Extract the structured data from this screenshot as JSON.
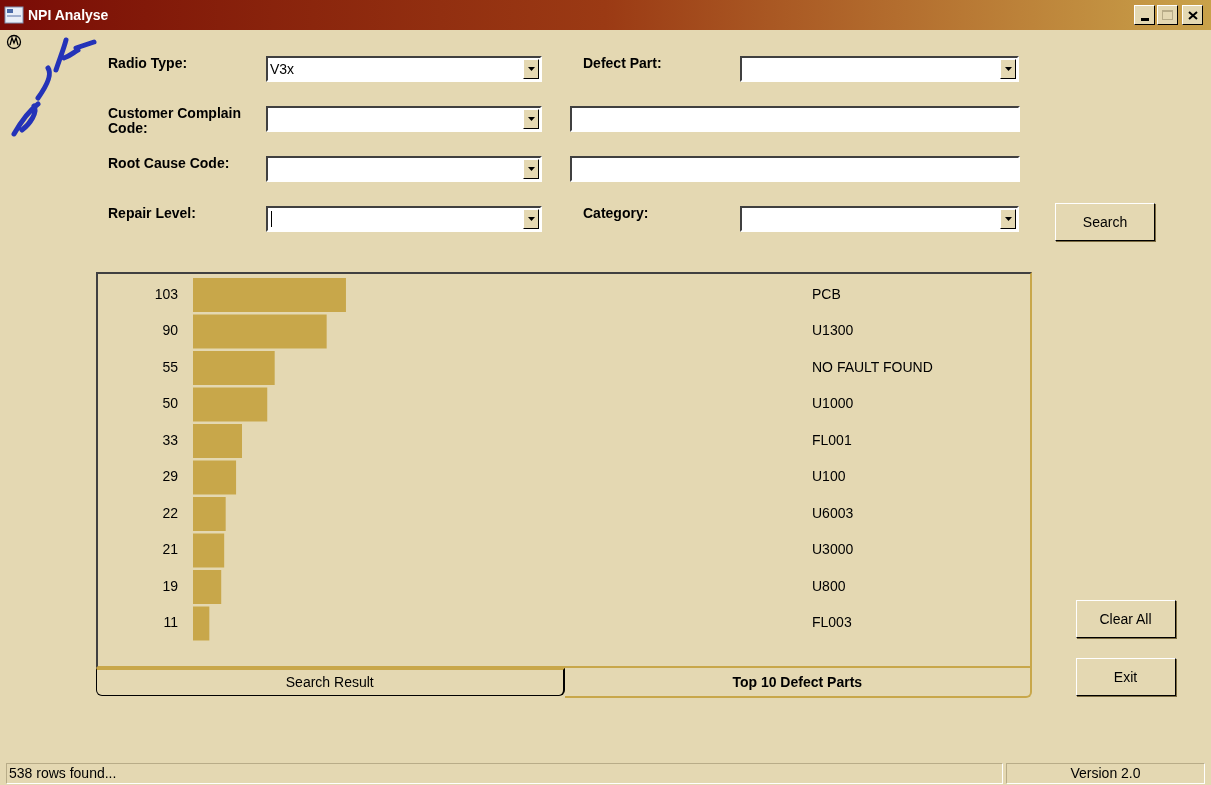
{
  "window": {
    "title": "NPI Analyse"
  },
  "form": {
    "rows": [
      {
        "label": "Radio Type:",
        "combo": {
          "value": "V3x",
          "focused": false
        },
        "second": {
          "kind": "combo",
          "label": "Defect Part:"
        }
      },
      {
        "label": "Customer Complain Code:",
        "combo": {
          "focused": false
        },
        "second": {
          "kind": "text"
        }
      },
      {
        "label": "Root Cause Code:",
        "combo": {
          "focused": false
        },
        "second": {
          "kind": "text"
        }
      },
      {
        "label": "Repair Level:",
        "combo": {
          "focused": true
        },
        "second": {
          "kind": "combo",
          "label": "Category:"
        }
      }
    ]
  },
  "buttons": {
    "search": "Search",
    "clear": "Clear All",
    "exit": "Exit"
  },
  "chart_panel": {
    "chart_data": {
      "type": "bar",
      "orientation": "horizontal",
      "data_labels": true,
      "categories": [
        "PCB",
        "U1300",
        "NO FAULT FOUND",
        "U1000",
        "FL001",
        "U100",
        "U6003",
        "U3000",
        "U800",
        "FL003"
      ],
      "series": [
        {
          "color": "#c8a74a",
          "values": [
            103,
            90,
            55,
            50,
            33,
            29,
            22,
            21,
            19,
            11
          ]
        }
      ]
    }
  },
  "tabs": [
    {
      "label": "Search Result",
      "selected": false
    },
    {
      "label": "Top 10 Defect Parts",
      "selected": true
    }
  ],
  "status_bar": {
    "message": "538 rows found...",
    "version": "Version 2.0"
  }
}
